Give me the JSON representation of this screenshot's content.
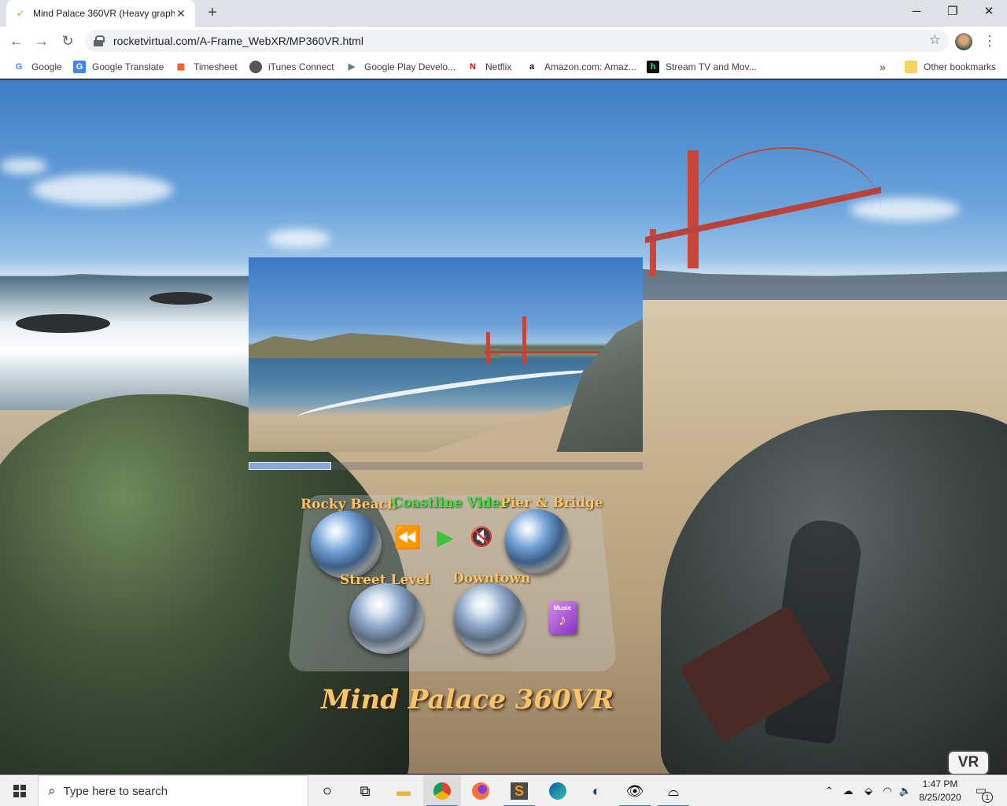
{
  "browser": {
    "tab_title": "Mind Palace 360VR (Heavy graph",
    "tab_close_icon": "close-icon",
    "new_tab_icon": "plus-icon",
    "window_controls": {
      "minimize": "─",
      "maximize": "❐",
      "close": "✕"
    },
    "url": "rocketvirtual.com/A-Frame_WebXR/MP360VR.html",
    "nav": {
      "back": "←",
      "forward": "→",
      "reload": "↻"
    },
    "bookmark_star": "☆",
    "menu": "⋮"
  },
  "bookmarks": {
    "items": [
      {
        "label": "Google",
        "icon": "G",
        "icon_color": "#4285f4"
      },
      {
        "label": "Google Translate",
        "icon": "G",
        "icon_color": "#4285f4"
      },
      {
        "label": "Timesheet",
        "icon": "▦",
        "icon_color": "#f4511e"
      },
      {
        "label": "iTunes Connect",
        "icon": "",
        "icon_color": "#555555"
      },
      {
        "label": "Google Play Develo...",
        "icon": "▶",
        "icon_color": "#607d8b"
      },
      {
        "label": "Netflix",
        "icon": "N",
        "icon_color": "#e50914"
      },
      {
        "label": "Amazon.com: Amaz...",
        "icon": "a",
        "icon_color": "#111111"
      },
      {
        "label": "Stream TV and Mov...",
        "icon": "h",
        "icon_color": "#1ce783"
      }
    ],
    "overflow": "»",
    "other": "Other bookmarks"
  },
  "vr": {
    "video_progress": 0.21,
    "panoramas": {
      "rocky_beach": "Rocky Beach",
      "coastline_video": "Coastline Video",
      "pier_bridge": "Pier & Bridge",
      "street_level": "Street Level",
      "downtown": "Downtown"
    },
    "controls": {
      "rewind": "⏪",
      "play": "▶",
      "mute": "🔇"
    },
    "music": {
      "label": "Music",
      "note": "♪"
    },
    "title": "Mind Palace 360VR",
    "vr_button": "VR",
    "colors": {
      "label_gold": "#f7c46a",
      "label_green": "#4cd94a",
      "play_green": "#3cc43c"
    }
  },
  "taskbar": {
    "search_placeholder": "Type here to search",
    "icons": [
      "task-view-icon",
      "file-explorer-icon",
      "chrome-icon",
      "firefox-icon",
      "sublime-icon",
      "edge-icon",
      "visual-studio-icon",
      "eye-app-icon",
      "vr-headset-icon"
    ],
    "time": "1:47 PM",
    "date": "8/25/2020",
    "notifications": "1"
  }
}
